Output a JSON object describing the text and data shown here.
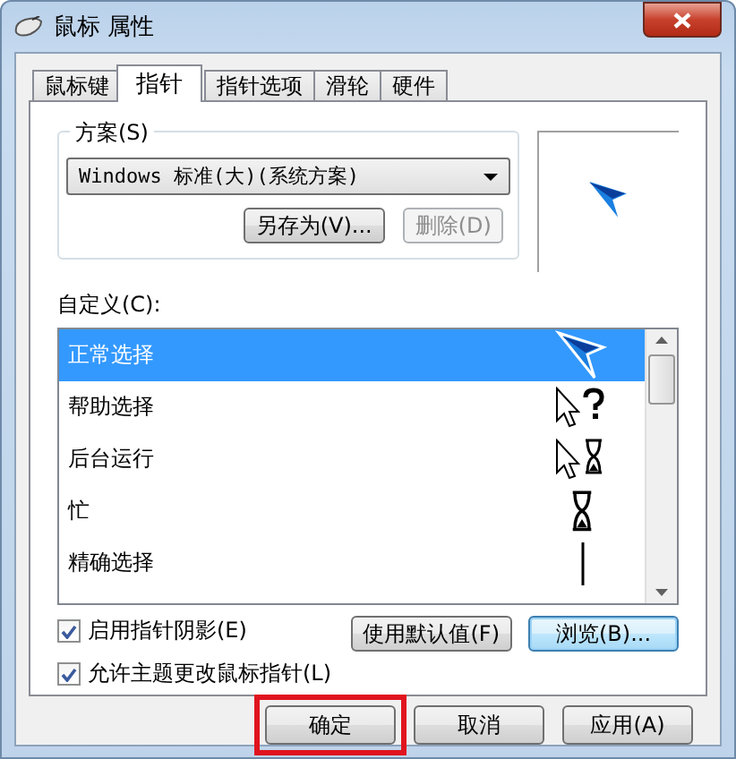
{
  "window": {
    "title": "鼠标 属性"
  },
  "tabs": [
    {
      "label": "鼠标键",
      "selected": false
    },
    {
      "label": "指针",
      "selected": true
    },
    {
      "label": "指针选项",
      "selected": false
    },
    {
      "label": "滑轮",
      "selected": false
    },
    {
      "label": "硬件",
      "selected": false
    }
  ],
  "scheme": {
    "label": "方案(S)",
    "value": "Windows 标准(大)(系统方案)",
    "buttons": [
      {
        "label": "另存为(V)...",
        "disabled": false
      },
      {
        "label": "删除(D)",
        "disabled": true
      }
    ]
  },
  "customize": {
    "label": "自定义(C):",
    "items": [
      {
        "label": "正常选择",
        "kind": "arrow",
        "selected": true
      },
      {
        "label": "帮助选择",
        "kind": "help",
        "selected": false
      },
      {
        "label": "后台运行",
        "kind": "working",
        "selected": false
      },
      {
        "label": "忙",
        "kind": "busy",
        "selected": false
      },
      {
        "label": "精确选择",
        "kind": "precision",
        "selected": false
      }
    ]
  },
  "options": [
    {
      "label": "启用指针阴影(E)",
      "checked": true
    },
    {
      "label": "允许主题更改鼠标指针(L)",
      "checked": true
    }
  ],
  "side_buttons": [
    {
      "label": "使用默认值(F)",
      "focused": false
    },
    {
      "label": "浏览(B)...",
      "focused": true
    }
  ],
  "footer_buttons": [
    {
      "label": "确定",
      "highlighted": true
    },
    {
      "label": "取消",
      "highlighted": false
    },
    {
      "label": "应用(A)",
      "highlighted": false
    }
  ]
}
